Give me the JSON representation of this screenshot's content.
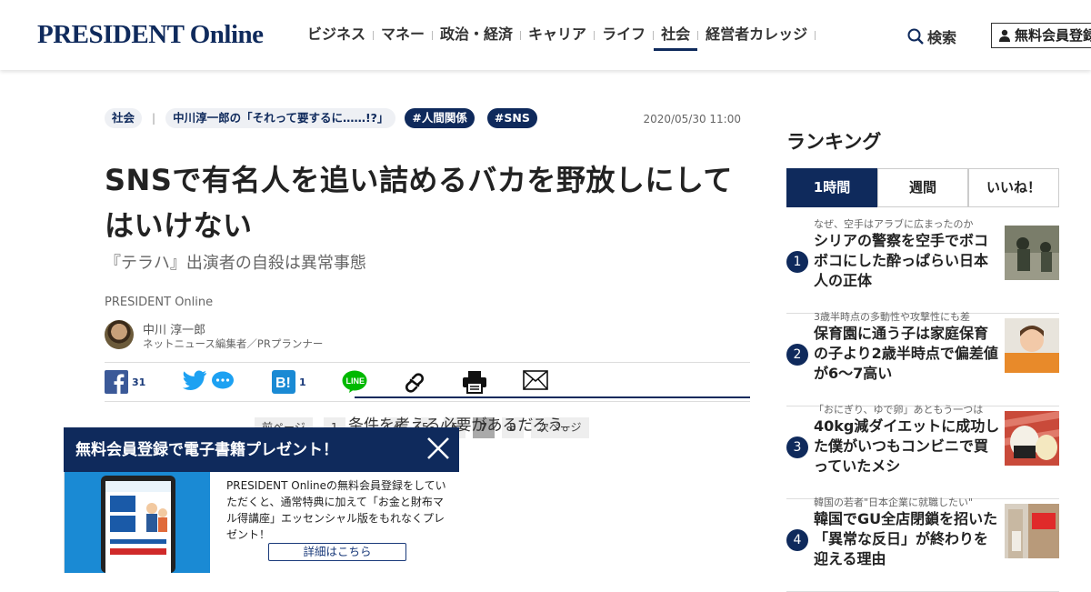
{
  "header": {
    "logo": "PRESIDENT Online",
    "nav": [
      "ビジネス",
      "マネー",
      "政治・経済",
      "キャリア",
      "ライフ",
      "社会",
      "経営者カレッジ"
    ],
    "active_nav": "社会",
    "search_label": "検索",
    "signup_label": "無料会員登録"
  },
  "article": {
    "category": "社会",
    "series": "中川淳一郎の「それって要するに……!?」",
    "tags": [
      "#人間関係",
      "#SNS"
    ],
    "date": "2020/05/30 11:00",
    "title": "SNSで有名人を追い詰めるバカを野放しにしてはいけない",
    "subtitle": "『テラハ』出演者の自殺は異常事態",
    "source": "PRESIDENT Online",
    "author_name": "中川 淳一郎",
    "author_role": "ネットニュース編集者／PRプランナー",
    "share": {
      "facebook_count": "31",
      "hatena_count": "1"
    },
    "pager": {
      "prev": "前ページ",
      "pages": [
        "1",
        "4",
        "5",
        "6",
        "7",
        "8"
      ],
      "current": "7",
      "next": "次ページ"
    },
    "body_fragment": "条件を考える必要があるだろう。"
  },
  "popup": {
    "title": "無料会員登録で電子書籍プレゼント！",
    "text": "PRESIDENT Onlineの無料会員登録をしていただくと、通常特典に加えて「お金と財布マル得講座」エッセンシャル版をもれなくプレゼント！",
    "button": "詳細はこちら"
  },
  "ranking": {
    "title": "ランキング",
    "tabs": [
      "1時間",
      "週間",
      "いいね！"
    ],
    "active_tab": "1時間",
    "items": [
      {
        "rank": "1",
        "kicker": "なぜ、空手はアラブに広まったのか",
        "headline": "シリアの警察を空手でボコボコにした酔っぱらい日本人の正体"
      },
      {
        "rank": "2",
        "kicker": "3歳半時点の多動性や攻撃性にも差",
        "headline": "保育園に通う子は家庭保育の子より2歳半時点で偏差値が6～7高い"
      },
      {
        "rank": "3",
        "kicker": "「おにぎり、ゆで卵」あともう一つは",
        "headline": "40kg減ダイエットに成功した僕がいつもコンビニで買っていたメシ"
      },
      {
        "rank": "4",
        "kicker": "韓国の若者\"日本企業に就職したい\"",
        "headline": "韓国でGU全店閉鎖を招いた「異常な反日」が終わりを迎える理由"
      }
    ]
  },
  "colors": {
    "brand": "#0f2a5c",
    "facebook": "#3b5998",
    "twitter": "#1da1f2",
    "line": "#00b900"
  }
}
